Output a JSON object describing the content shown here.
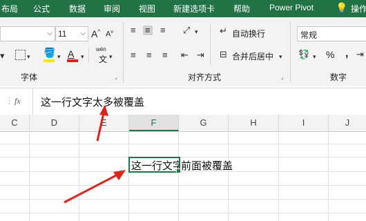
{
  "ribbon_tabs": [
    "布局",
    "公式",
    "数据",
    "审阅",
    "视图",
    "新建选项卡",
    "帮助",
    "Power Pivot",
    "操作"
  ],
  "font": {
    "size_value": "11",
    "grow_label": "A",
    "shrink_label": "A",
    "wen_label": "wén",
    "wen_char": "文",
    "group_label": "字体"
  },
  "alignment": {
    "wrap_text_label": "自动换行",
    "merge_center_label": "合并后居中",
    "group_label": "对齐方式"
  },
  "number": {
    "format_value": "常规",
    "percent_label": "%",
    "comma_label": ",",
    "group_label": "数字"
  },
  "formula_bar": {
    "fx_label": "fx",
    "content": "这一行文字太多被覆盖"
  },
  "columns": [
    "C",
    "D",
    "E",
    "F",
    "G",
    "H",
    "I",
    "J"
  ],
  "active_column": "F",
  "cells": {
    "f_visible_text": "这一行文字",
    "g_text": "前面被覆盖"
  },
  "colors": {
    "ribbon_green": "#217346",
    "active_cell_border": "#217346",
    "arrow_red": "#e0221b",
    "highlight_yellow": "#ffe600",
    "font_red": "#e0221b"
  }
}
